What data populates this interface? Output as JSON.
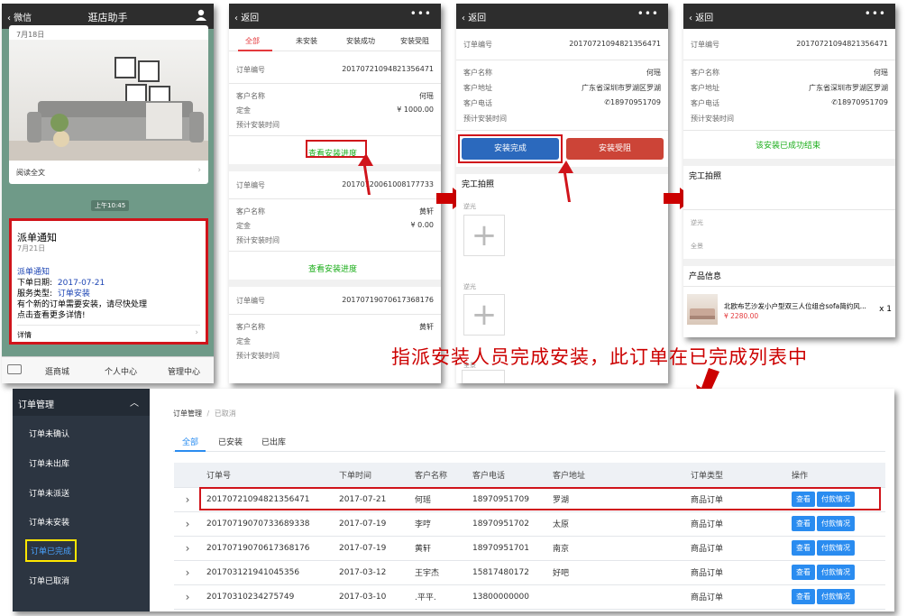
{
  "panel1": {
    "back": "微信",
    "title": "逛店助手",
    "date_top": "7月18日",
    "read_more": "阅读全文",
    "time": "上午10:45",
    "notice_title": "派单通知",
    "notice_date": "7月21日",
    "notice_label": "派单通知",
    "order_date_label": "下单日期:",
    "order_date": "2017-07-21",
    "service_label": "服务类型:",
    "service": "订单安装",
    "line1": "有个新的订单需要安装，请尽快处理",
    "line2": "点击查看更多详情!",
    "details": "详情",
    "menu": [
      "逛商城",
      "个人中心",
      "管理中心"
    ]
  },
  "panel2": {
    "back": "返回",
    "more": "•••",
    "tabs": [
      "全部",
      "未安装",
      "安装成功",
      "安装受阻"
    ],
    "orders": [
      {
        "no_label": "订单编号",
        "no": "20170721094821356471",
        "cust_label": "客户名称",
        "cust": "何瑶",
        "dep_label": "定金",
        "dep": "¥ 1000.00",
        "time_label": "预计安装时间",
        "action": "查看安装进度"
      },
      {
        "no_label": "订单编号",
        "no": "20170720061008177733",
        "cust_label": "客户名称",
        "cust": "黄轩",
        "dep_label": "定金",
        "dep": "¥ 0.00",
        "time_label": "预计安装时间",
        "action": "查看安装进度"
      },
      {
        "no_label": "订单编号",
        "no": "20170719070617368176",
        "cust_label": "客户名称",
        "cust": "黄轩",
        "dep_label": "定金",
        "dep": "",
        "time_label": "预计安装时间",
        "action": ""
      }
    ]
  },
  "panel3": {
    "back": "返回",
    "more": "•••",
    "no_label": "订单编号",
    "no": "20170721094821356471",
    "cust_label": "客户名称",
    "cust": "何瑶",
    "addr_label": "客户地址",
    "addr": "广东省深圳市罗湖区罗湖",
    "phone_label": "客户电话",
    "phone": "18970951709",
    "time_label": "预计安装时间",
    "btn_done": "安装完成",
    "btn_block": "安装受阻",
    "photo_title": "完工拍照",
    "photo1": "逆光",
    "photo2": "逆光",
    "photo3": "全景"
  },
  "panel4": {
    "back": "返回",
    "more": "•••",
    "no_label": "订单编号",
    "no": "20170721094821356471",
    "cust_label": "客户名称",
    "cust": "何瑶",
    "addr_label": "客户地址",
    "addr": "广东省深圳市罗湖区罗湖",
    "phone_label": "客户电话",
    "phone": "18970951709",
    "time_label": "预计安装时间",
    "success": "该安装已成功结束",
    "photo_title": "完工拍照",
    "photo2": "逆光",
    "photo3": "全景",
    "product_title": "产品信息",
    "product_name": "北欧布艺沙发小户型双三人位组合sofa简约风...",
    "product_price": "¥ 2280.00",
    "product_qty": "x 1"
  },
  "caption": "指派安装人员完成安装，此订单在已完成列表中",
  "admin": {
    "sidebar_title": "订单管理",
    "sidebar_items": [
      "订单未确认",
      "订单未出库",
      "订单未派送",
      "订单未安装",
      "订单已完成",
      "订单已取消"
    ],
    "breadcrumb_root": "订单管理",
    "breadcrumb_sep": "/",
    "breadcrumb_current": "已取消",
    "tabs": [
      "全部",
      "已安装",
      "已出库"
    ],
    "columns": [
      "订单号",
      "下单时间",
      "客户名称",
      "客户电话",
      "客户地址",
      "订单类型",
      "操作"
    ],
    "btn_view": "查看",
    "btn_pay": "付款情况",
    "rows": [
      [
        "20170721094821356471",
        "2017-07-21",
        "何瑶",
        "18970951709",
        "罗湖",
        "商品订单"
      ],
      [
        "20170719070733689338",
        "2017-07-19",
        "李哼",
        "18970951702",
        "太原",
        "商品订单"
      ],
      [
        "20170719070617368176",
        "2017-07-19",
        "黄轩",
        "18970951701",
        "南京",
        "商品订单"
      ],
      [
        "201703121941045356",
        "2017-03-12",
        "王宇杰",
        "15817480172",
        "好吧",
        "商品订单"
      ],
      [
        "20170310234275749",
        "2017-03-10",
        ".平平.",
        "13800000000",
        "",
        "商品订单"
      ]
    ]
  },
  "colors": {
    "accent": "#2a8cf0",
    "red": "#d0141b",
    "green": "#1aad19",
    "dark": "#2d2d2d",
    "sidebar": "#2c3541"
  }
}
